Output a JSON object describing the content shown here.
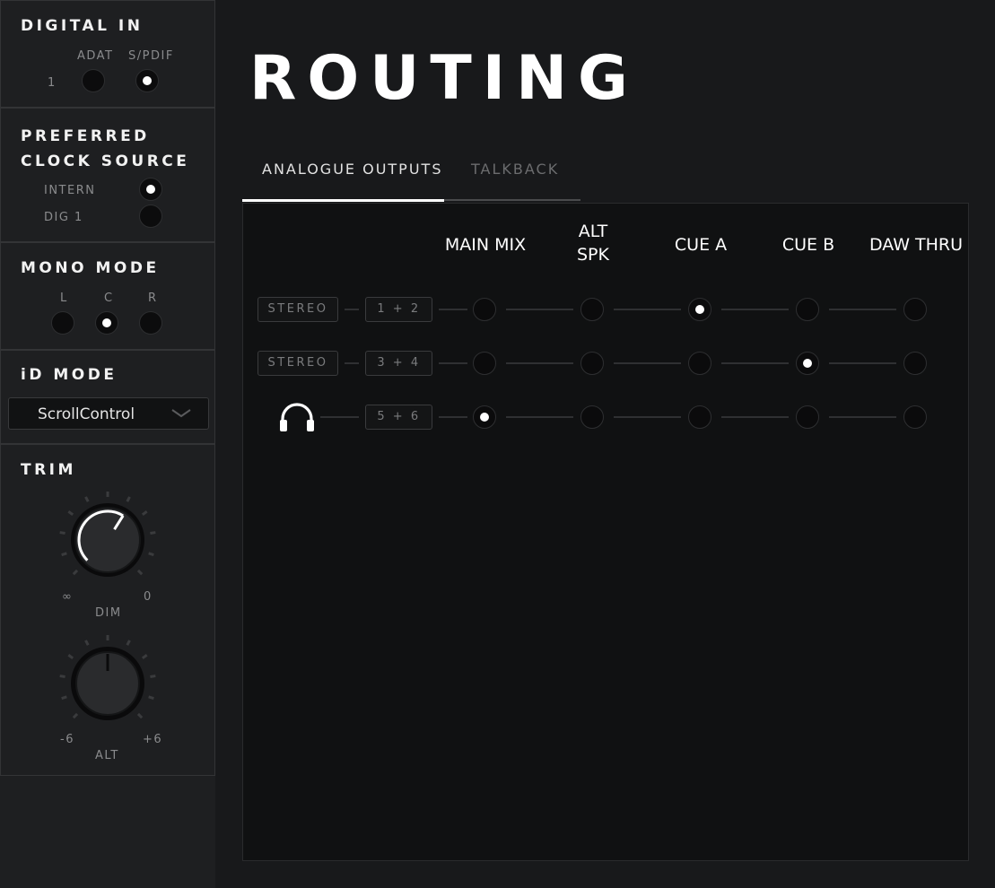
{
  "sidebar": {
    "digital_in": {
      "title": "DIGITAL IN",
      "row_label": "1",
      "col_adat": "ADAT",
      "col_spdif": "S/PDIF",
      "selected": "S/PDIF"
    },
    "clock_source": {
      "title_line1": "PREFERRED",
      "title_line2": "CLOCK SOURCE",
      "options": [
        "INTERN",
        "DIG 1"
      ],
      "selected": "INTERN"
    },
    "mono_mode": {
      "title": "MONO MODE",
      "options": [
        "L",
        "C",
        "R"
      ],
      "selected": "C"
    },
    "id_mode": {
      "title": "iD MODE",
      "value": "ScrollControl"
    },
    "trim": {
      "title": "TRIM",
      "dim": {
        "label": "DIM",
        "min_label": "∞",
        "max_label": "0",
        "level": 0.62
      },
      "alt": {
        "label": "ALT",
        "min_label": "-6",
        "max_label": "+6",
        "level": 0.5
      }
    }
  },
  "main": {
    "title": "ROUTING",
    "tabs": [
      {
        "label": "ANALOGUE OUTPUTS",
        "active": true
      },
      {
        "label": "TALKBACK",
        "active": false
      }
    ],
    "columns": [
      "MAIN MIX",
      "ALT\nSPK",
      "CUE A",
      "CUE B",
      "DAW THRU"
    ],
    "rows": [
      {
        "mode": "STEREO",
        "channels": "1 + 2",
        "icon": null,
        "selected_column": "CUE A"
      },
      {
        "mode": "STEREO",
        "channels": "3 + 4",
        "icon": null,
        "selected_column": "CUE B"
      },
      {
        "mode": null,
        "channels": "5 + 6",
        "icon": "headphones-icon",
        "selected_column": "MAIN MIX"
      }
    ]
  },
  "colors": {
    "background": "#18191b",
    "panel": "#1e1f21",
    "text": "#ffffff",
    "muted": "#8a8b8d",
    "tab_underline_active": "#ffffff",
    "tab_underline_inactive": "#4a4b4d"
  }
}
